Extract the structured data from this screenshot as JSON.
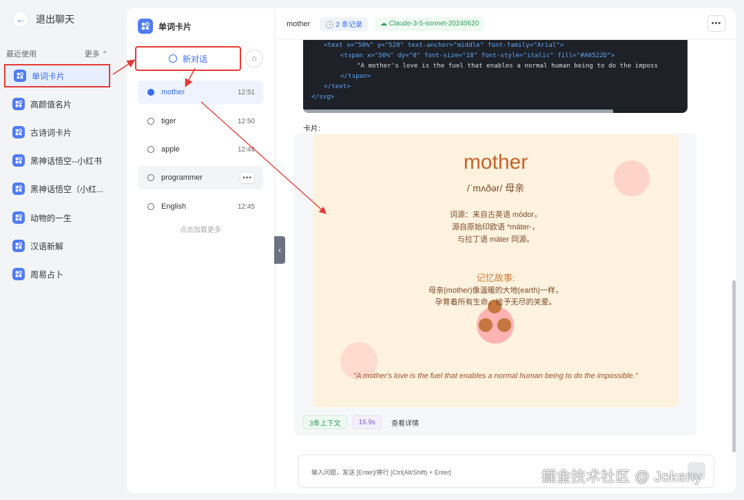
{
  "sidebar": {
    "back_label": "退出聊天",
    "recent_label": "最近使用",
    "more_label": "更多 ⌃",
    "items": [
      {
        "label": "单词卡片"
      },
      {
        "label": "高颜值名片"
      },
      {
        "label": "古诗词卡片"
      },
      {
        "label": "黑神话悟空--小红书"
      },
      {
        "label": "黑神话悟空（小红..."
      },
      {
        "label": "动物的一生"
      },
      {
        "label": "汉语新解"
      },
      {
        "label": "周易占卜"
      }
    ]
  },
  "conversations": {
    "title": "单词卡片",
    "new_chat_label": "新对话",
    "clean_icon": "broom-icon",
    "items": [
      {
        "name": "mother",
        "time": "12:51"
      },
      {
        "name": "tiger",
        "time": "12:50"
      },
      {
        "name": "apple",
        "time": "12:49"
      },
      {
        "name": "programmer",
        "time": ""
      },
      {
        "name": "English",
        "time": "12:45"
      }
    ],
    "load_more": "点击加载更多"
  },
  "chat": {
    "title": "mother",
    "record_badge": "🕓 2 条记录",
    "model_badge": "☁ Claude-3-5-sonnet-20240620",
    "code_lines": [
      "<text x=\"50%\" y=\"520\" text-anchor=\"middle\" font-family=\"Arial\">",
      "<tspan x=\"50%\" dy=\"0\" font-size=\"18\" font-style=\"italic\" fill=\"#A0522D\">",
      "\"A mother's love is the fuel that enables a normal human being to do the imposs",
      "</tspan>",
      "</text>",
      "</svg>"
    ],
    "card_label": "卡片:",
    "card": {
      "word": "mother",
      "phonetic": "/ˈmʌðər/ 母亲",
      "etymology_1": "词源：来自古英语 mōdor，",
      "etymology_2": "源自原始印欧语 *māter-，",
      "etymology_3": "与拉丁语 māter 同源。",
      "story_heading": "记忆故事:",
      "story_1": "母亲(mother)像温暖的大地(earth)一样，",
      "story_2": "孕育着所有生命，给予无尽的关爱。",
      "quote": "\"A mother's love is the fuel that enables a normal human being to do the impossible.\""
    },
    "meta_context": "3条上下文",
    "meta_time": "16.9s",
    "meta_detail": "查看详情",
    "input_placeholder": "输入问题，发送 [Enter]/换行 [Ctrl(Alt/Shift) + Enter]"
  },
  "watermark": "掘金技术社区 @ Jokeny",
  "colors": {
    "accent": "#3b6cf5",
    "annotation_red": "#e53935",
    "card_bg": "#fff2de",
    "word_color": "#c2622b"
  }
}
